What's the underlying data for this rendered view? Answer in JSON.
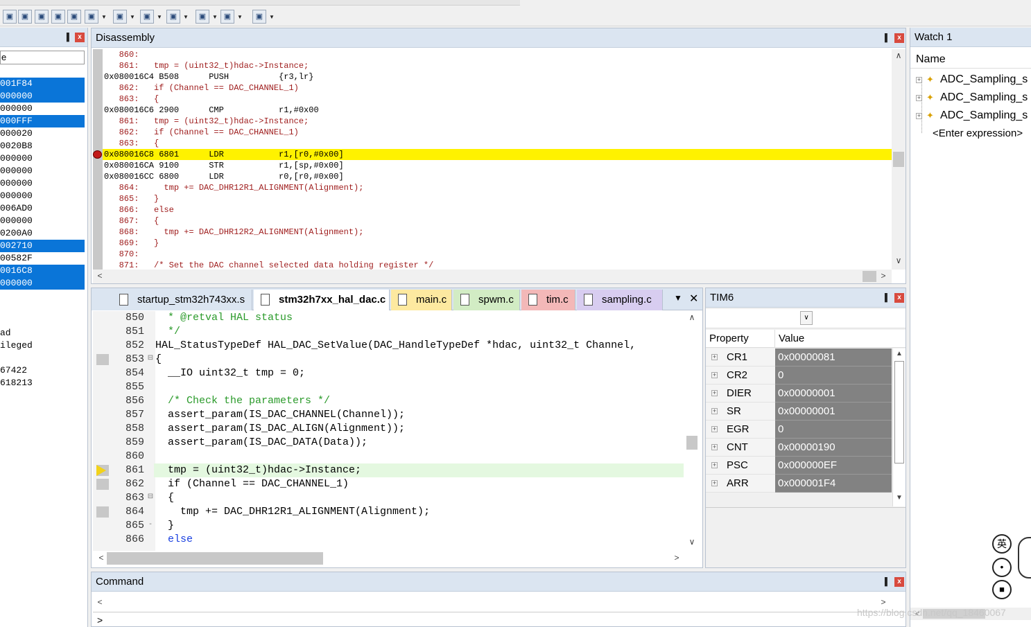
{
  "toolbar": {
    "buttons": [
      "command-window-icon",
      "disassembly-window-icon",
      "symbols-window-icon",
      "registers-window-icon",
      "call-stack-icon",
      "watch-window-icon",
      "memory-window-icon",
      "serial-window-icon",
      "analysis-window-icon",
      "trace-window-icon",
      "system-viewer-icon",
      "toolbox-icon"
    ]
  },
  "left_panel": {
    "header": "e",
    "rows": [
      {
        "text": "001F84",
        "selected": true
      },
      {
        "text": "000000",
        "selected": true
      },
      {
        "text": "000000",
        "selected": false
      },
      {
        "text": "000FFF",
        "selected": true
      },
      {
        "text": "000020",
        "selected": false
      },
      {
        "text": "0020B8",
        "selected": false
      },
      {
        "text": "000000",
        "selected": false
      },
      {
        "text": "000000",
        "selected": false
      },
      {
        "text": "000000",
        "selected": false
      },
      {
        "text": "000000",
        "selected": false
      },
      {
        "text": "006AD0",
        "selected": false
      },
      {
        "text": "000000",
        "selected": false
      },
      {
        "text": "0200A0",
        "selected": false
      },
      {
        "text": "002710",
        "selected": true
      },
      {
        "text": "00582F",
        "selected": false
      },
      {
        "text": "0016C8",
        "selected": true
      },
      {
        "text": "000000",
        "selected": true
      }
    ],
    "bottom_lines": [
      "ad",
      "ileged",
      "",
      "67422",
      "618213"
    ]
  },
  "disassembly": {
    "title": "Disassembly",
    "lines": [
      {
        "kind": "src",
        "text": "   860:"
      },
      {
        "kind": "src",
        "text": "   861:   tmp = (uint32_t)hdac->Instance;"
      },
      {
        "kind": "asm",
        "text": "0x080016C4 B508      PUSH          {r3,lr}"
      },
      {
        "kind": "src",
        "text": "   862:   if (Channel == DAC_CHANNEL_1)"
      },
      {
        "kind": "src",
        "text": "   863:   {"
      },
      {
        "kind": "asm",
        "text": "0x080016C6 2900      CMP           r1,#0x00"
      },
      {
        "kind": "src",
        "text": "   861:   tmp = (uint32_t)hdac->Instance;"
      },
      {
        "kind": "src",
        "text": "   862:   if (Channel == DAC_CHANNEL_1)"
      },
      {
        "kind": "src",
        "text": "   863:   {"
      },
      {
        "kind": "cur",
        "text": "0x080016C8 6801      LDR           r1,[r0,#0x00]"
      },
      {
        "kind": "asm",
        "text": "0x080016CA 9100      STR           r1,[sp,#0x00]"
      },
      {
        "kind": "asm",
        "text": "0x080016CC 6800      LDR           r0,[r0,#0x00]"
      },
      {
        "kind": "src",
        "text": "   864:     tmp += DAC_DHR12R1_ALIGNMENT(Alignment);"
      },
      {
        "kind": "src",
        "text": "   865:   }"
      },
      {
        "kind": "src",
        "text": "   866:   else"
      },
      {
        "kind": "src",
        "text": "   867:   {"
      },
      {
        "kind": "src",
        "text": "   868:     tmp += DAC_DHR12R2_ALIGNMENT(Alignment);"
      },
      {
        "kind": "src",
        "text": "   869:   }"
      },
      {
        "kind": "src",
        "text": "   870:"
      },
      {
        "kind": "src",
        "text": "   871:   /* Set the DAC channel selected data holding register */"
      }
    ]
  },
  "editor": {
    "tabs": [
      {
        "label": "startup_stm32h743xx.s",
        "color": "#dbe5f1",
        "active": false
      },
      {
        "label": "stm32h7xx_hal_dac.c",
        "color": "#ffffff",
        "active": true
      },
      {
        "label": "main.c",
        "color": "#fde9a0",
        "active": false
      },
      {
        "label": "spwm.c",
        "color": "#d2ecc4",
        "active": false
      },
      {
        "label": "tim.c",
        "color": "#f3b8b8",
        "active": false
      },
      {
        "label": "sampling.c",
        "color": "#d8cdf0",
        "active": false
      }
    ],
    "lines": [
      {
        "n": "850",
        "code": "  * @retval HAL status",
        "cls": "cmt"
      },
      {
        "n": "851",
        "code": "  */",
        "cls": "cmt"
      },
      {
        "n": "852",
        "code": "HAL_StatusTypeDef HAL_DAC_SetValue(DAC_HandleTypeDef *hdac, uint32_t Channel,",
        "cls": ""
      },
      {
        "n": "853",
        "code": "{",
        "cls": "",
        "gut": true,
        "fold": "⊟"
      },
      {
        "n": "854",
        "code": "  __IO uint32_t tmp = 0;",
        "cls": ""
      },
      {
        "n": "855",
        "code": "",
        "cls": ""
      },
      {
        "n": "856",
        "code": "  /* Check the parameters */",
        "cls": "cmt"
      },
      {
        "n": "857",
        "code": "  assert_param(IS_DAC_CHANNEL(Channel));",
        "cls": ""
      },
      {
        "n": "858",
        "code": "  assert_param(IS_DAC_ALIGN(Alignment));",
        "cls": ""
      },
      {
        "n": "859",
        "code": "  assert_param(IS_DAC_DATA(Data));",
        "cls": ""
      },
      {
        "n": "860",
        "code": "",
        "cls": ""
      },
      {
        "n": "861",
        "code": "  tmp = (uint32_t)hdac->Instance;",
        "cls": "",
        "cur": true
      },
      {
        "n": "862",
        "code": "  if (Channel == DAC_CHANNEL_1)",
        "cls": "",
        "gut": true
      },
      {
        "n": "863",
        "code": "  {",
        "cls": "",
        "fold": "⊟"
      },
      {
        "n": "864",
        "code": "    tmp += DAC_DHR12R1_ALIGNMENT(Alignment);",
        "cls": "",
        "gut": true
      },
      {
        "n": "865",
        "code": "  }",
        "cls": "",
        "fold": "-"
      },
      {
        "n": "866",
        "code": "  else",
        "cls": "kw"
      }
    ]
  },
  "tim6": {
    "title": "TIM6",
    "col_property": "Property",
    "col_value": "Value",
    "rows": [
      {
        "name": "CR1",
        "value": "0x00000081"
      },
      {
        "name": "CR2",
        "value": "0"
      },
      {
        "name": "DIER",
        "value": "0x00000001"
      },
      {
        "name": "SR",
        "value": "0x00000001"
      },
      {
        "name": "EGR",
        "value": "0"
      },
      {
        "name": "CNT",
        "value": "0x00000190"
      },
      {
        "name": "PSC",
        "value": "0x000000EF"
      },
      {
        "name": "ARR",
        "value": "0x000001F4"
      }
    ]
  },
  "watch": {
    "title": "Watch 1",
    "col_name": "Name",
    "items": [
      "ADC_Sampling_s",
      "ADC_Sampling_s",
      "ADC_Sampling_s"
    ],
    "enter_expression": "<Enter expression>"
  },
  "command": {
    "title": "Command",
    "prompt": ">"
  },
  "ime": {
    "lang_glyph": "英",
    "watermark": "https://blog.csdn.net/qq_18460067"
  }
}
